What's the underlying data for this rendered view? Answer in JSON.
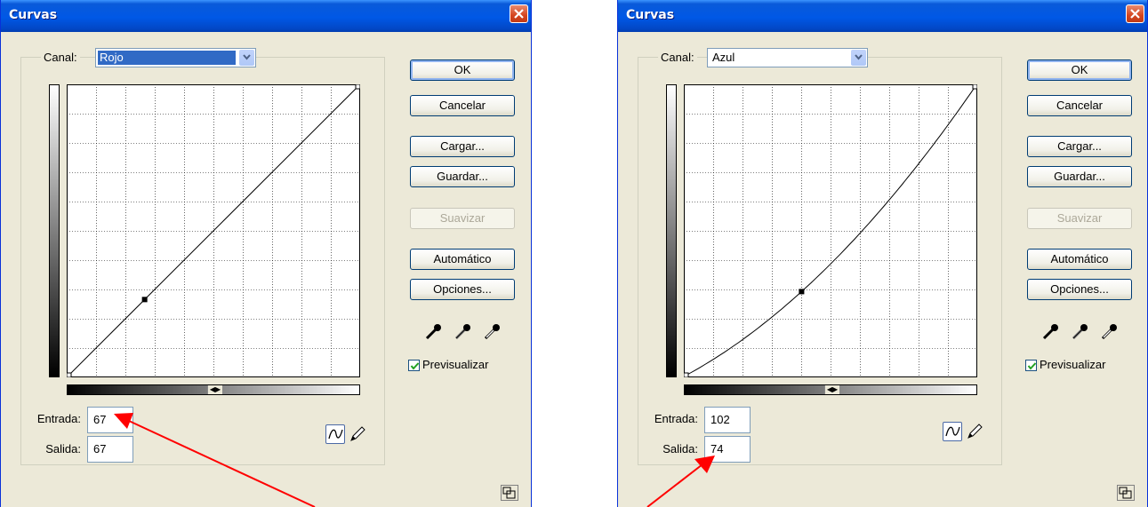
{
  "dialogs": [
    {
      "title": "Curvas",
      "canal_label": "Canal:",
      "canal_value": "Rojo",
      "canal_selected": true,
      "input_label": "Entrada:",
      "input_value": "67",
      "output_label": "Salida:",
      "output_value": "67",
      "buttons": {
        "ok": "OK",
        "cancel": "Cancelar",
        "load": "Cargar...",
        "save": "Guardar...",
        "smooth": "Suavizar",
        "auto": "Automático",
        "options": "Opciones..."
      },
      "preview_label": "Previsualizar",
      "preview_checked": true,
      "curve_point": {
        "input": 67,
        "output": 67
      }
    },
    {
      "title": "Curvas",
      "canal_label": "Canal:",
      "canal_value": "Azul",
      "canal_selected": false,
      "input_label": "Entrada:",
      "input_value": "102",
      "output_label": "Salida:",
      "output_value": "74",
      "buttons": {
        "ok": "OK",
        "cancel": "Cancelar",
        "load": "Cargar...",
        "save": "Guardar...",
        "smooth": "Suavizar",
        "auto": "Automático",
        "options": "Opciones..."
      },
      "preview_label": "Previsualizar",
      "preview_checked": true,
      "curve_point": {
        "input": 102,
        "output": 74
      }
    }
  ],
  "colors": {
    "titlebar": "#0058e6",
    "annotation_arrow": "#ff0000",
    "dialog_bg": "#ece9d8"
  }
}
